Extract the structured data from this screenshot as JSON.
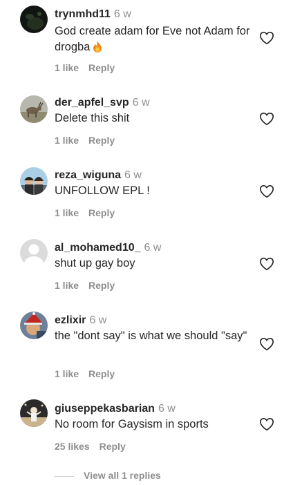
{
  "colors": {
    "text": "#262626",
    "muted": "#8e8e8e"
  },
  "icons": {
    "like": "heart-outline-icon",
    "emoji": "fire-emoji-icon"
  },
  "comments": [
    {
      "username": "trynmhd11",
      "time": "6 w",
      "text": "God create adam for Eve not Adam for drogba",
      "emoji": "🔥",
      "likes": "1 like",
      "reply": "Reply"
    },
    {
      "username": "der_apfel_svp",
      "time": "6 w",
      "text": "Delete this shit",
      "likes": "1 like",
      "reply": "Reply"
    },
    {
      "username": "reza_wiguna",
      "time": "6 w",
      "text": "UNFOLLOW EPL !",
      "likes": "1 like",
      "reply": "Reply"
    },
    {
      "username": "al_mohamed10_",
      "time": "6 w",
      "text": "shut up gay boy",
      "likes": "1 like",
      "reply": "Reply"
    },
    {
      "username": "ezlixir",
      "time": "6 w",
      "text": "the \"dont say\" is what we should \"say\"",
      "likes": "1 like",
      "reply": "Reply"
    },
    {
      "username": "giuseppekasbarian",
      "time": "6 w",
      "text": "No room for Gaysism in sports",
      "likes": "25 likes",
      "reply": "Reply"
    }
  ],
  "view_replies": "View all 1 replies"
}
